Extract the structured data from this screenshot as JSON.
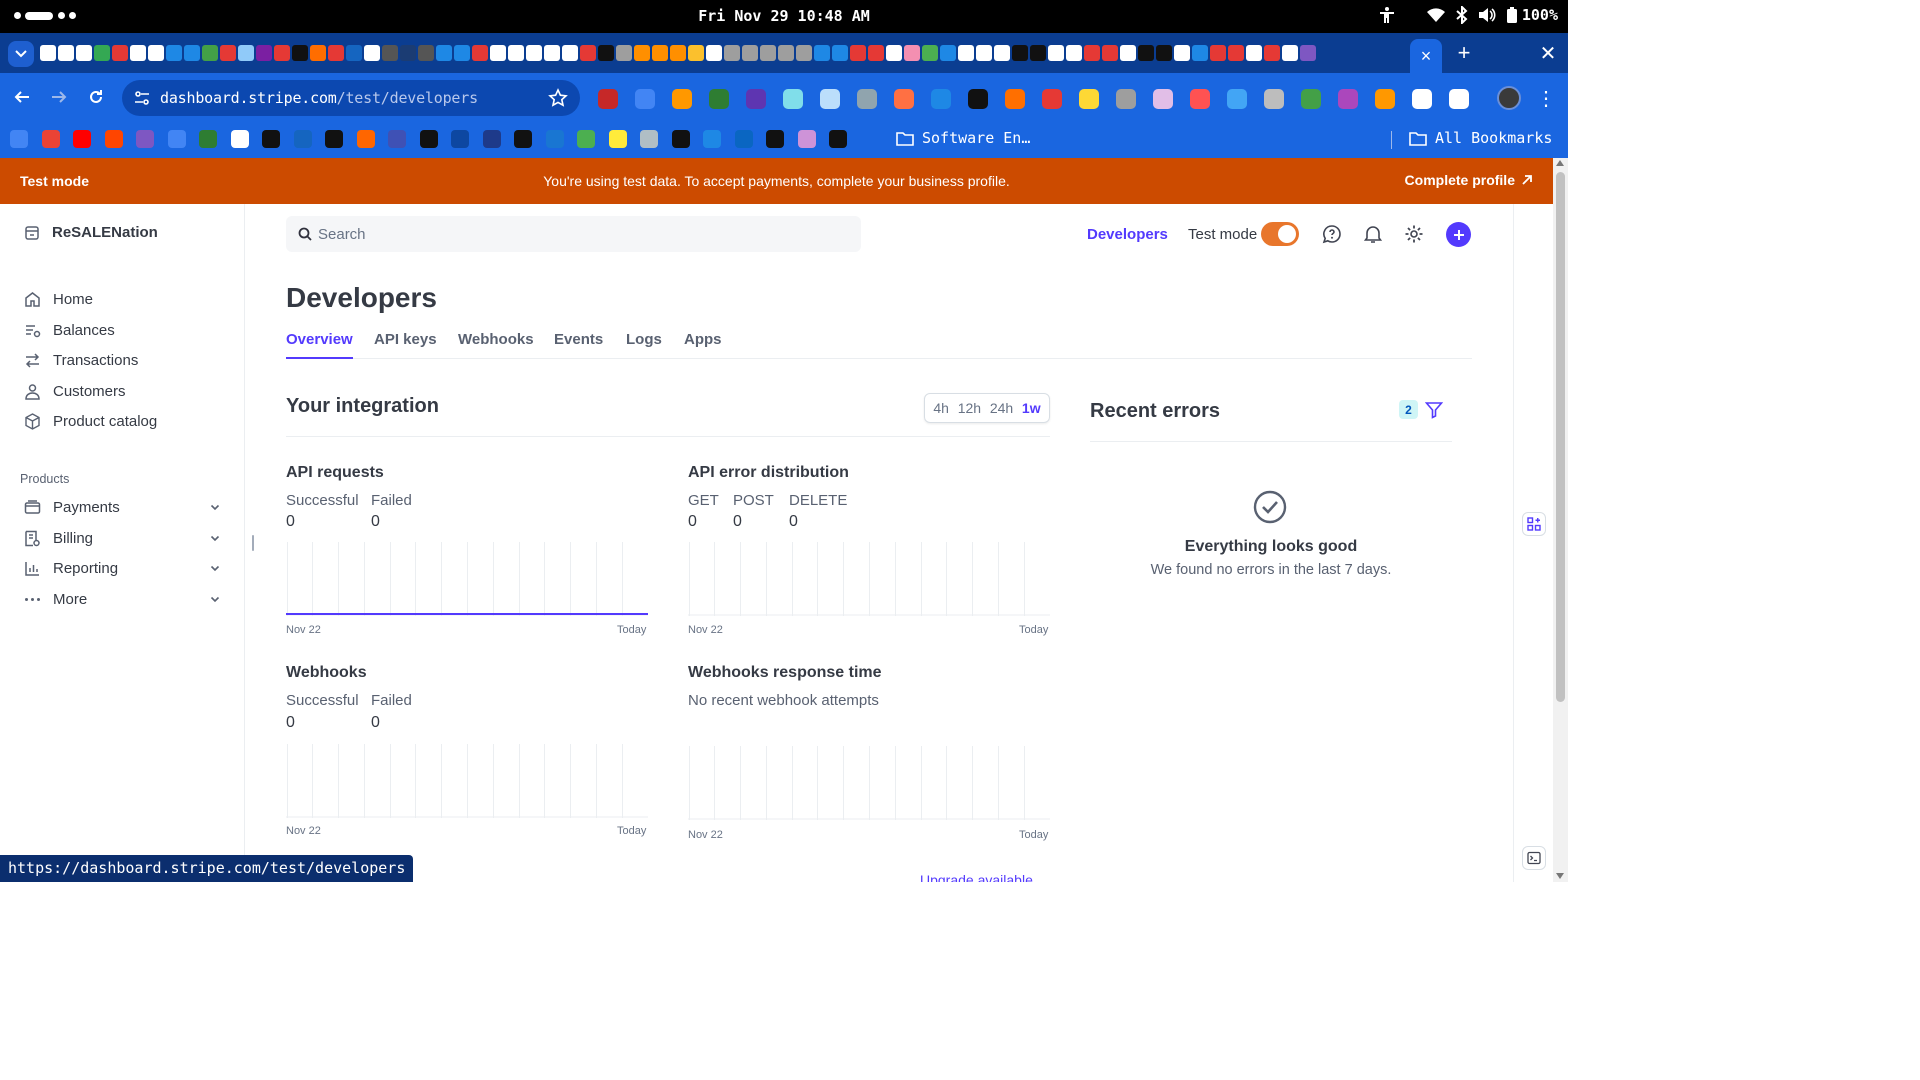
{
  "os": {
    "clock": "Fri Nov 29 10:48 AM",
    "battery": "100%"
  },
  "browser": {
    "url_host": "dashboard.stripe.com",
    "url_path": "/test/developers",
    "bookmark_folder": "Software En…",
    "all_bookmarks": "All Bookmarks",
    "status_url": "https://dashboard.stripe.com/test/developers",
    "tab_icon_colors": [
      "#ffffff",
      "#ffffff",
      "#ffffff",
      "#34a853",
      "#e53935",
      "#ffffff",
      "#ffffff",
      "#1e88e5",
      "#1e88e5",
      "#43a047",
      "#e53935",
      "#90caf9",
      "#7b1fa2",
      "#e53935",
      "#111111",
      "#ff6d00",
      "#e53935",
      "#1565c0",
      "#ffffff",
      "#555555",
      "#1b3c73",
      "#555555",
      "#1e88e5",
      "#1e88e5",
      "#e53935",
      "#ffffff",
      "#ffffff",
      "#ffffff",
      "#ffffff",
      "#ffffff",
      "#e53935",
      "#111111",
      "#9e9e9e",
      "#ff8f00",
      "#ff8f00",
      "#ff8f00",
      "#fbc02d",
      "#ffffff",
      "#9e9e9e",
      "#9e9e9e",
      "#9e9e9e",
      "#9e9e9e",
      "#9e9e9e",
      "#1e88e5",
      "#1e88e5",
      "#e53935",
      "#e53935",
      "#ffffff",
      "#f48fb1",
      "#4caf50",
      "#1e88e5",
      "#ffffff",
      "#ffffff",
      "#ffffff",
      "#111111",
      "#111111",
      "#ffffff",
      "#ffffff",
      "#e53935",
      "#e53935",
      "#ffffff",
      "#111111",
      "#111111",
      "#ffffff",
      "#1e88e5",
      "#e53935",
      "#e53935",
      "#ffffff",
      "#e53935",
      "#ffffff",
      "#7e57c2"
    ],
    "extension_icon_colors": [
      "#c62828",
      "#4285f4",
      "#ff9800",
      "#2e7d32",
      "#5e35b1",
      "#80deea",
      "#bbdefb",
      "#90a4ae",
      "#ff7043",
      "#1e88e5",
      "#111111",
      "#ff6f00",
      "#e53935",
      "#fdd835",
      "#9e9e9e",
      "#e1bee7",
      "#ff5252",
      "#42a5f5",
      "#bdbdbd",
      "#43a047",
      "#ab47bc",
      "#ff9800",
      "#ffffff",
      "#ffffff"
    ],
    "bookmark_icon_colors": [
      "#4285f4",
      "#ea4335",
      "#ff0000",
      "#ff4500",
      "#7e57c2",
      "#4285f4",
      "#2e7d32",
      "#ffffff",
      "#111111",
      "#1565c0",
      "#111111",
      "#ff6600",
      "#3f51b5",
      "#111111",
      "#0d47a1",
      "#1e3a8a",
      "#111111",
      "#1976d2",
      "#4caf50",
      "#ffeb3b",
      "#b0bec5",
      "#111111",
      "#1e88e5",
      "#0a66c2",
      "#111111",
      "#ce93d8",
      "#111111"
    ]
  },
  "banner": {
    "label": "Test mode",
    "message": "You're using test data. To accept payments, complete your business profile.",
    "link": "Complete profile"
  },
  "sidebar": {
    "account": "ReSALENation",
    "items": [
      {
        "label": "Home",
        "icon": "home-icon"
      },
      {
        "label": "Balances",
        "icon": "balances-icon"
      },
      {
        "label": "Transactions",
        "icon": "transactions-icon"
      },
      {
        "label": "Customers",
        "icon": "customers-icon"
      },
      {
        "label": "Product catalog",
        "icon": "product-catalog-icon"
      }
    ],
    "products_label": "Products",
    "products": [
      {
        "label": "Payments",
        "icon": "payments-icon"
      },
      {
        "label": "Billing",
        "icon": "billing-icon"
      },
      {
        "label": "Reporting",
        "icon": "reporting-icon"
      },
      {
        "label": "More",
        "icon": "more-icon"
      }
    ]
  },
  "header": {
    "search_placeholder": "Search",
    "developers_link": "Developers",
    "test_mode_label": "Test mode",
    "test_mode_on": true
  },
  "main": {
    "title": "Developers",
    "tabs": [
      "Overview",
      "API keys",
      "Webhooks",
      "Events",
      "Logs",
      "Apps"
    ],
    "active_tab": "Overview",
    "integration": {
      "title": "Your integration",
      "ranges": [
        "4h",
        "12h",
        "24h",
        "1w"
      ],
      "selected_range": "1w"
    },
    "api_requests": {
      "title": "API requests",
      "successful_label": "Successful",
      "successful": "0",
      "failed_label": "Failed",
      "failed": "0",
      "x_start": "Nov 22",
      "x_end": "Today"
    },
    "api_errors": {
      "title": "API error distribution",
      "get_label": "GET",
      "get": "0",
      "post_label": "POST",
      "post": "0",
      "delete_label": "DELETE",
      "delete": "0",
      "x_start": "Nov 22",
      "x_end": "Today"
    },
    "webhooks": {
      "title": "Webhooks",
      "successful_label": "Successful",
      "successful": "0",
      "failed_label": "Failed",
      "failed": "0",
      "x_start": "Nov 22",
      "x_end": "Today"
    },
    "webhook_response": {
      "title": "Webhooks response time",
      "message": "No recent webhook attempts",
      "x_start": "Nov 22",
      "x_end": "Today"
    },
    "upgrade_link": "Upgrade available"
  },
  "errors": {
    "title": "Recent errors",
    "badge": "2",
    "ok_title": "Everything looks good",
    "ok_sub": "We found no errors in the last 7 days."
  },
  "colors": {
    "accent": "#533afd",
    "test_banner": "#cc4b00",
    "toggle_on": "#e8762c"
  }
}
